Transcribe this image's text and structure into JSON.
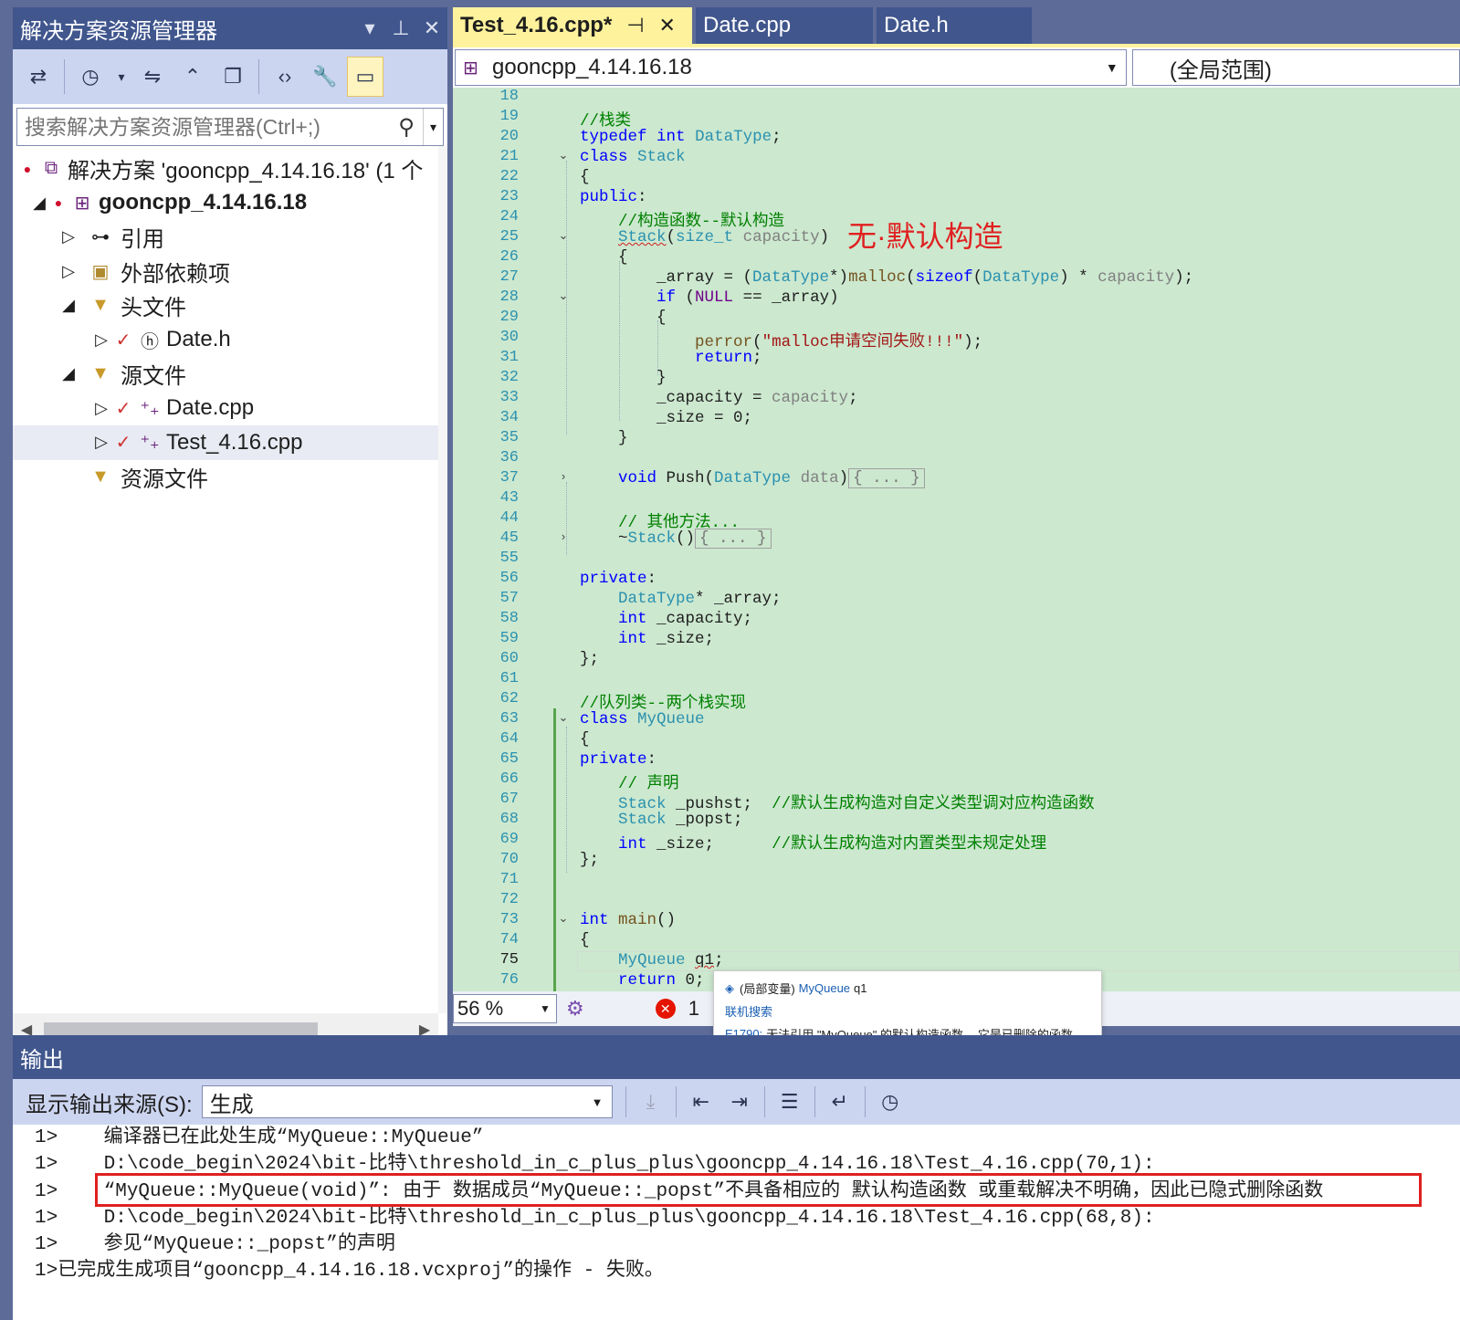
{
  "solution_explorer": {
    "title": "解决方案资源管理器",
    "search_placeholder": "搜索解决方案资源管理器(Ctrl+;)",
    "tree": [
      {
        "label": "解决方案 'gooncpp_4.14.16.18' (1 个"
      },
      {
        "label": "gooncpp_4.14.16.18"
      },
      {
        "label": "引用"
      },
      {
        "label": "外部依赖项"
      },
      {
        "label": "头文件"
      },
      {
        "label": "Date.h"
      },
      {
        "label": "源文件"
      },
      {
        "label": "Date.cpp"
      },
      {
        "label": "Test_4.16.cpp"
      },
      {
        "label": "资源文件"
      }
    ]
  },
  "editor": {
    "tabs": [
      {
        "label": "Test_4.16.cpp*",
        "active": true
      },
      {
        "label": "Date.cpp",
        "active": false
      },
      {
        "label": "Date.h",
        "active": false
      }
    ],
    "nav_project": "gooncpp_4.14.16.18",
    "nav_scope": "(全局范围)",
    "annotation": "无·默认构造",
    "zoom": "56 %",
    "error_count": "1",
    "lines": [
      {
        "n": "18",
        "t": ""
      },
      {
        "n": "19",
        "t": "//栈类"
      },
      {
        "n": "20",
        "t": "typedef int DataType;"
      },
      {
        "n": "21",
        "t": "class Stack"
      },
      {
        "n": "22",
        "t": "{"
      },
      {
        "n": "23",
        "t": "public:"
      },
      {
        "n": "24",
        "t": "    //构造函数--默认构造"
      },
      {
        "n": "25",
        "t": "    Stack(size_t capacity)"
      },
      {
        "n": "26",
        "t": "    {"
      },
      {
        "n": "27",
        "t": "        _array = (DataType*)malloc(sizeof(DataType) * capacity);"
      },
      {
        "n": "28",
        "t": "        if (NULL == _array)"
      },
      {
        "n": "29",
        "t": "        {"
      },
      {
        "n": "30",
        "t": "            perror(\"malloc申请空间失败!!!\");"
      },
      {
        "n": "31",
        "t": "            return;"
      },
      {
        "n": "32",
        "t": "        }"
      },
      {
        "n": "33",
        "t": "        _capacity = capacity;"
      },
      {
        "n": "34",
        "t": "        _size = 0;"
      },
      {
        "n": "35",
        "t": "    }"
      },
      {
        "n": "36",
        "t": ""
      },
      {
        "n": "37",
        "t": "    void Push(DataType data){ ... }"
      },
      {
        "n": "43",
        "t": ""
      },
      {
        "n": "44",
        "t": "    // 其他方法..."
      },
      {
        "n": "45",
        "t": "    ~Stack(){ ... }"
      },
      {
        "n": "55",
        "t": ""
      },
      {
        "n": "56",
        "t": "private:"
      },
      {
        "n": "57",
        "t": "    DataType* _array;"
      },
      {
        "n": "58",
        "t": "    int _capacity;"
      },
      {
        "n": "59",
        "t": "    int _size;"
      },
      {
        "n": "60",
        "t": "};"
      },
      {
        "n": "61",
        "t": ""
      },
      {
        "n": "62",
        "t": "//队列类--两个栈实现"
      },
      {
        "n": "63",
        "t": "class MyQueue"
      },
      {
        "n": "64",
        "t": "{"
      },
      {
        "n": "65",
        "t": "private:"
      },
      {
        "n": "66",
        "t": "    // 声明"
      },
      {
        "n": "67",
        "t": "    Stack _pushst;  //默认生成构造对自定义类型调对应构造函数"
      },
      {
        "n": "68",
        "t": "    Stack _popst;"
      },
      {
        "n": "69",
        "t": "    int _size;      //默认生成构造对内置类型未规定处理"
      },
      {
        "n": "70",
        "t": "};"
      },
      {
        "n": "71",
        "t": ""
      },
      {
        "n": "72",
        "t": ""
      },
      {
        "n": "73",
        "t": "int main()"
      },
      {
        "n": "74",
        "t": "{"
      },
      {
        "n": "75",
        "t": "    MyQueue q1;"
      },
      {
        "n": "76",
        "t": "    return 0;"
      }
    ]
  },
  "tooltip": {
    "line1_prefix": "(局部变量)",
    "line1_type": "MyQueue",
    "line1_var": "q1",
    "online_search": "联机搜索",
    "error_code": "E1790:",
    "error_text": "无法引用 \"MyQueue\" 的默认构造函数 -- 它是已删除的函数"
  },
  "output": {
    "title": "输出",
    "source_label": "显示输出来源(S):",
    "source_value": "生成",
    "lines": [
      "1>    编译器已在此处生成“MyQueue::MyQueue”",
      "1>    D:\\code_begin\\2024\\bit-比特\\threshold_in_c_plus_plus\\gooncpp_4.14.16.18\\Test_4.16.cpp(70,1):",
      "1>    “MyQueue::MyQueue(void)”: 由于 数据成员“MyQueue::_popst”不具备相应的 默认构造函数 或重载解决不明确，因此已隐式删除函数",
      "1>    D:\\code_begin\\2024\\bit-比特\\threshold_in_c_plus_plus\\gooncpp_4.14.16.18\\Test_4.16.cpp(68,8):",
      "1>    参见“MyQueue::_popst”的声明",
      "1>已完成生成项目“gooncpp_4.14.16.18.vcxproj”的操作 - 失败。"
    ]
  },
  "colors": {
    "chrome": "#40568d",
    "active_tab": "#fff29d",
    "editor_bg": "#cce8cf",
    "highlight_box": "#e02020"
  }
}
